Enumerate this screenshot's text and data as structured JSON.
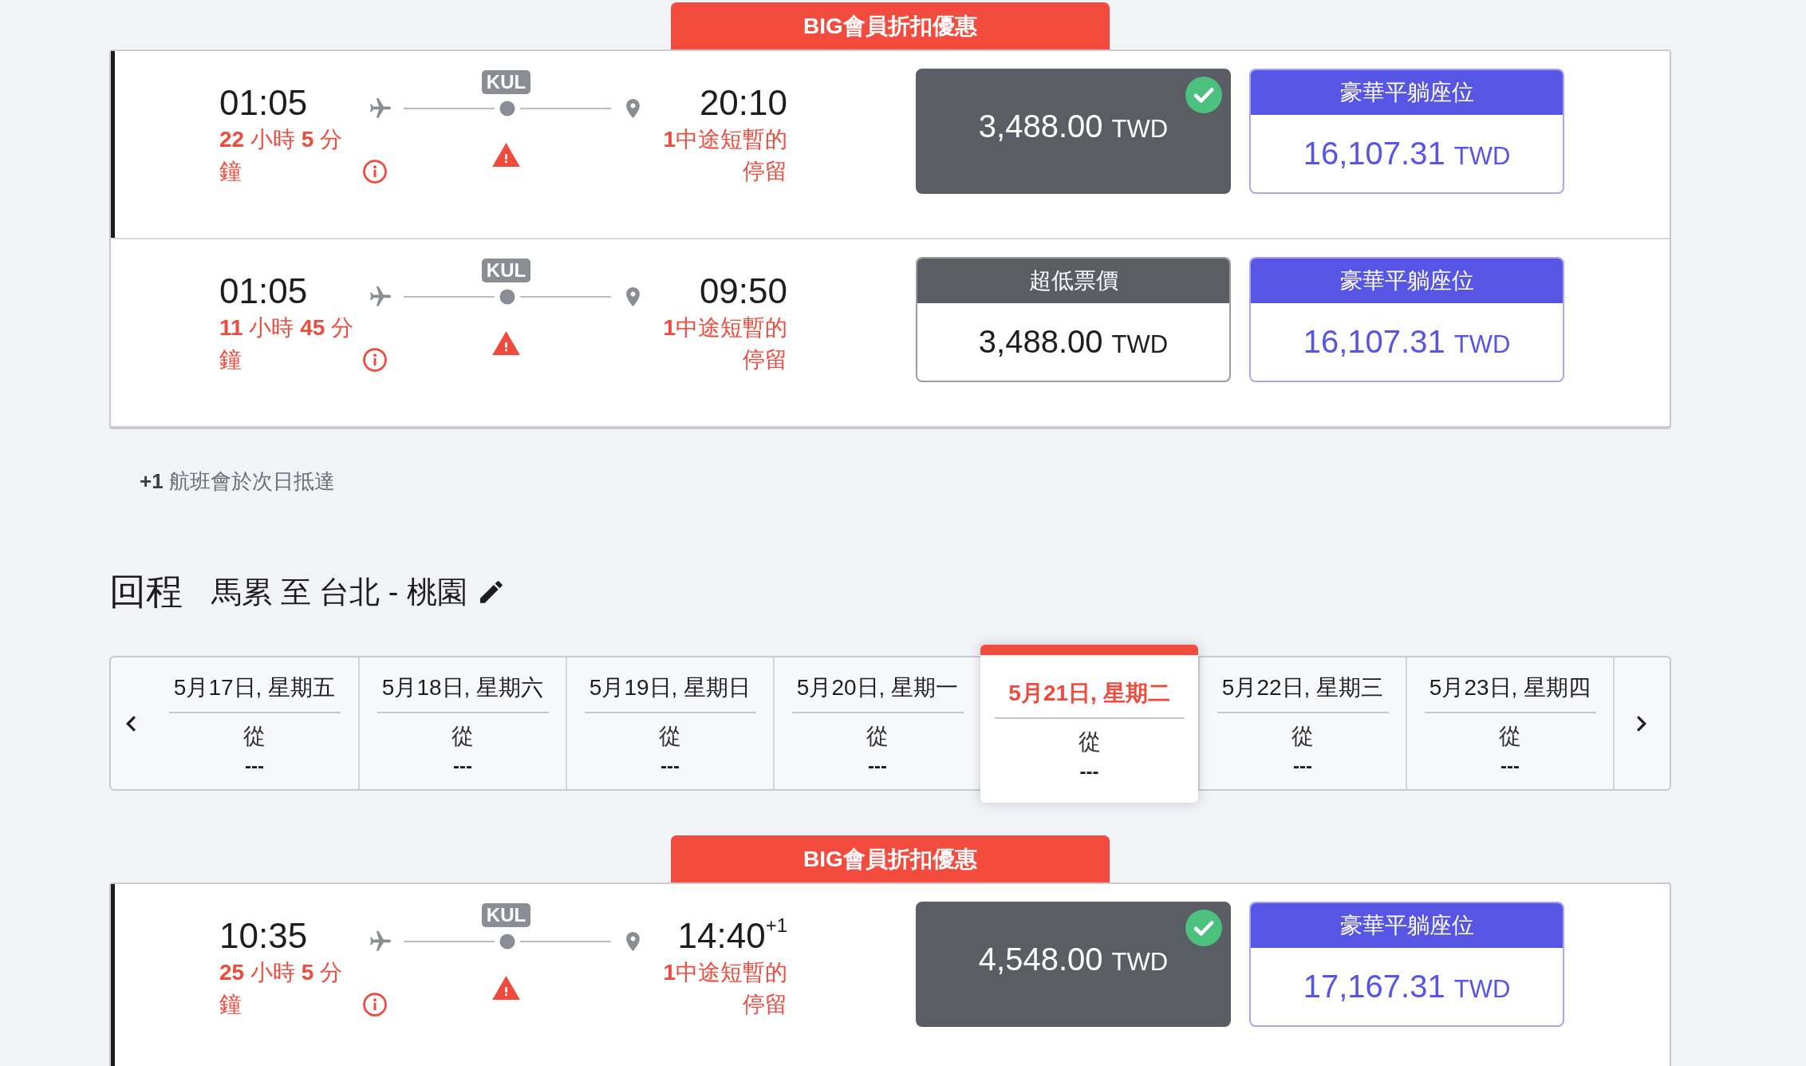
{
  "outbound": {
    "promo_label": "BIG會員折扣優惠",
    "flights": [
      {
        "selected": true,
        "depart_time": "01:05",
        "duration": "**22** 小時 **5** 分鐘",
        "stop_code": "KUL",
        "arrive_time": "20:10",
        "stops": "**1**中途短暫的停留",
        "fares": [
          {
            "kind": "standard",
            "price": "3,488.00",
            "currency": "TWD",
            "selected": true
          },
          {
            "kind": "premium",
            "label": "豪華平躺座位",
            "price": "16,107.31",
            "currency": "TWD",
            "selected": false
          }
        ]
      },
      {
        "selected": false,
        "depart_time": "01:05",
        "duration": "**11** 小時 **45** 分鐘",
        "stop_code": "KUL",
        "arrive_time": "09:50",
        "stops": "**1**中途短暫的停留",
        "fares": [
          {
            "kind": "standard",
            "label": "超低票價",
            "price": "3,488.00",
            "currency": "TWD",
            "selected": false
          },
          {
            "kind": "premium",
            "label": "豪華平躺座位",
            "price": "16,107.31",
            "currency": "TWD",
            "selected": false
          }
        ]
      }
    ],
    "footnote": "**+1** 航班會於次日抵達"
  },
  "return": {
    "title": "回程",
    "route": "馬累 至 台北 - 桃園",
    "dates": [
      {
        "label": "5月17日, 星期五",
        "from_label": "從",
        "price": "---",
        "selected": false
      },
      {
        "label": "5月18日, 星期六",
        "from_label": "從",
        "price": "---",
        "selected": false
      },
      {
        "label": "5月19日, 星期日",
        "from_label": "從",
        "price": "---",
        "selected": false
      },
      {
        "label": "5月20日, 星期一",
        "from_label": "從",
        "price": "---",
        "selected": false
      },
      {
        "label": "5月21日, 星期二",
        "from_label": "從",
        "price": "---",
        "selected": true
      },
      {
        "label": "5月22日, 星期三",
        "from_label": "從",
        "price": "---",
        "selected": false
      },
      {
        "label": "5月23日, 星期四",
        "from_label": "從",
        "price": "---",
        "selected": false
      }
    ],
    "promo_label": "BIG會員折扣優惠",
    "flights": [
      {
        "selected": true,
        "depart_time": "10:35",
        "duration": "**25** 小時 **5** 分鐘",
        "stop_code": "KUL",
        "arrive_time": "14:40$^{+1}$",
        "stops": "**1**中途短暫的停留",
        "fares": [
          {
            "kind": "standard",
            "price": "4,548.00",
            "currency": "TWD",
            "selected": true
          },
          {
            "kind": "premium",
            "label": "豪華平躺座位",
            "price": "17,167.31",
            "currency": "TWD",
            "selected": false
          }
        ]
      }
    ]
  }
}
